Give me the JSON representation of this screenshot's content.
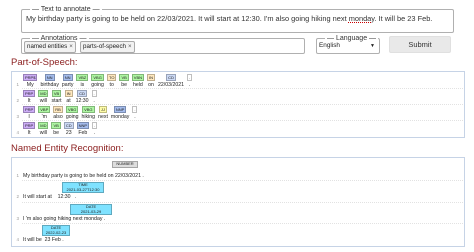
{
  "form": {
    "text_legend": "Text to annotate",
    "text_value_a": "My birthday party is going to be held on 22/03/2021. It will start at 12:30. I'm also going hiking next ",
    "text_value_b": "monday",
    "text_value_c": ". It will be 23 Feb.",
    "annotations_legend": "Annotations",
    "annotations": [
      {
        "label": "named entities",
        "remove": "×"
      },
      {
        "label": "parts-of-speech",
        "remove": "×"
      }
    ],
    "language_legend": "Language",
    "language_value": "English",
    "submit_label": "Submit"
  },
  "pos": {
    "title": "Part-of-Speech:",
    "lines": [
      {
        "num": "1",
        "tokens": [
          "My",
          "birthday",
          "party",
          "is",
          "going",
          "to",
          "be",
          "held",
          "on",
          "22/03/2021",
          "."
        ],
        "tags": [
          "PRP$",
          "NN",
          "NN",
          "VBZ",
          "VBG",
          "TO",
          "VB",
          "VBN",
          "IN",
          "CD",
          "."
        ]
      },
      {
        "num": "2",
        "tokens": [
          "It",
          "will",
          "start",
          "at",
          "12:30",
          "."
        ],
        "tags": [
          "PRP",
          "MD",
          "VB",
          "IN",
          "CD",
          "."
        ]
      },
      {
        "num": "3",
        "tokens": [
          "I",
          "'m",
          "also",
          "going",
          "hiking",
          "next",
          "monday",
          "."
        ],
        "tags": [
          "PRP",
          "VBP",
          "RB",
          "VBG",
          "VBG",
          "JJ",
          "NNP",
          "."
        ]
      },
      {
        "num": "4",
        "tokens": [
          "It",
          "will",
          "be",
          "23",
          "Feb",
          "."
        ],
        "tags": [
          "PRP",
          "MD",
          "VB",
          "CD",
          "NNP",
          "."
        ]
      }
    ]
  },
  "ner": {
    "title": "Named Entity Recognition:",
    "lines": [
      {
        "num": "1",
        "text": "My birthday party is going to be held on 22/03/2021 .",
        "entity": "NUMBER",
        "entity_value": ""
      },
      {
        "num": "2",
        "text": "It will start at    12:30   .",
        "entity": "TIME",
        "entity_value": "2021-03-27T12:30"
      },
      {
        "num": "3",
        "text": "I 'm also going hiking next monday .",
        "entity": "DATE",
        "entity_value": "2021-03-29"
      },
      {
        "num": "4",
        "text": "It will be  23 Feb .",
        "entity": "DATE",
        "entity_value": "2022-02-23"
      }
    ]
  },
  "colors": {
    "section_title": "#8b1e1e",
    "PRP$": "#ccadf6",
    "PRP": "#ccadf6",
    "NN": "#a4bced",
    "NNP": "#a4bced",
    "VBZ": "#adf6a2",
    "VBG": "#adf6a2",
    "VB": "#adf6a2",
    "VBN": "#adf6a2",
    "VBP": "#adf6a2",
    "TO": "#ffe8be",
    "IN": "#ffe8be",
    "MD": "#adf6a2",
    "RB": "#ffe8be",
    "JJ": "#fffda8",
    "CD": "#ccdaf6",
    ".": "#ffffff",
    "NUMBER": "#dddddd",
    "TIME": "#7fe2ff",
    "DATE": "#7fe2ff"
  }
}
